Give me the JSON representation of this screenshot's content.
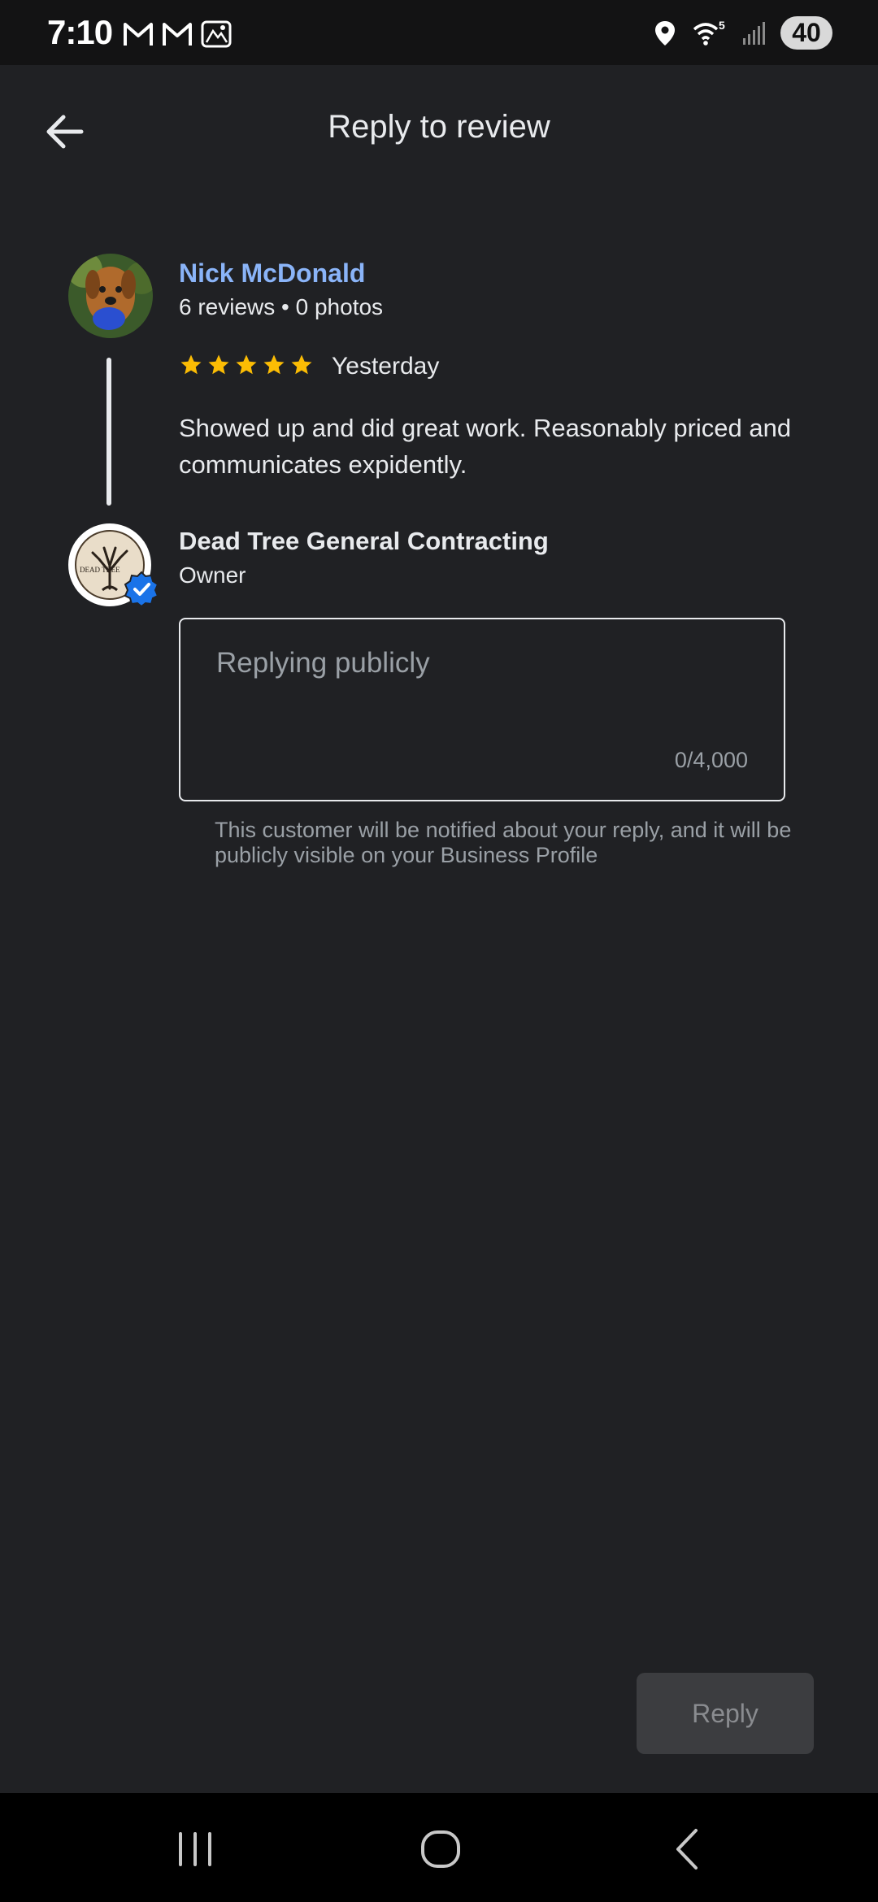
{
  "status_bar": {
    "time": "7:10",
    "left_icons": [
      "gmail-icon",
      "gmail-icon",
      "image-notification-icon"
    ],
    "right_icons": [
      "location-icon",
      "wifi-icon",
      "signal-icon"
    ],
    "wifi_label": "5",
    "battery": "40"
  },
  "app_bar": {
    "title": "Reply to review",
    "back_icon": "arrow-back-icon"
  },
  "review": {
    "reviewer_name": "Nick McDonald",
    "reviewer_meta": "6 reviews • 0 photos",
    "rating": 5,
    "date": "Yesterday",
    "text": "Showed up and did great work. Reasonably priced and communicates expidently."
  },
  "owner": {
    "name": "Dead Tree General Contracting",
    "role": "Owner",
    "logo_text": "DEAD TREE"
  },
  "reply": {
    "placeholder": "Replying publicly",
    "counter": "0/4,000",
    "notice": "This customer will be notified about your reply, and it will be publicly visible on your Business Profile",
    "button_label": "Reply"
  },
  "colors": {
    "background": "#202124",
    "link": "#8ab4f8",
    "star": "#fbbc04",
    "verified": "#1a73e8"
  }
}
